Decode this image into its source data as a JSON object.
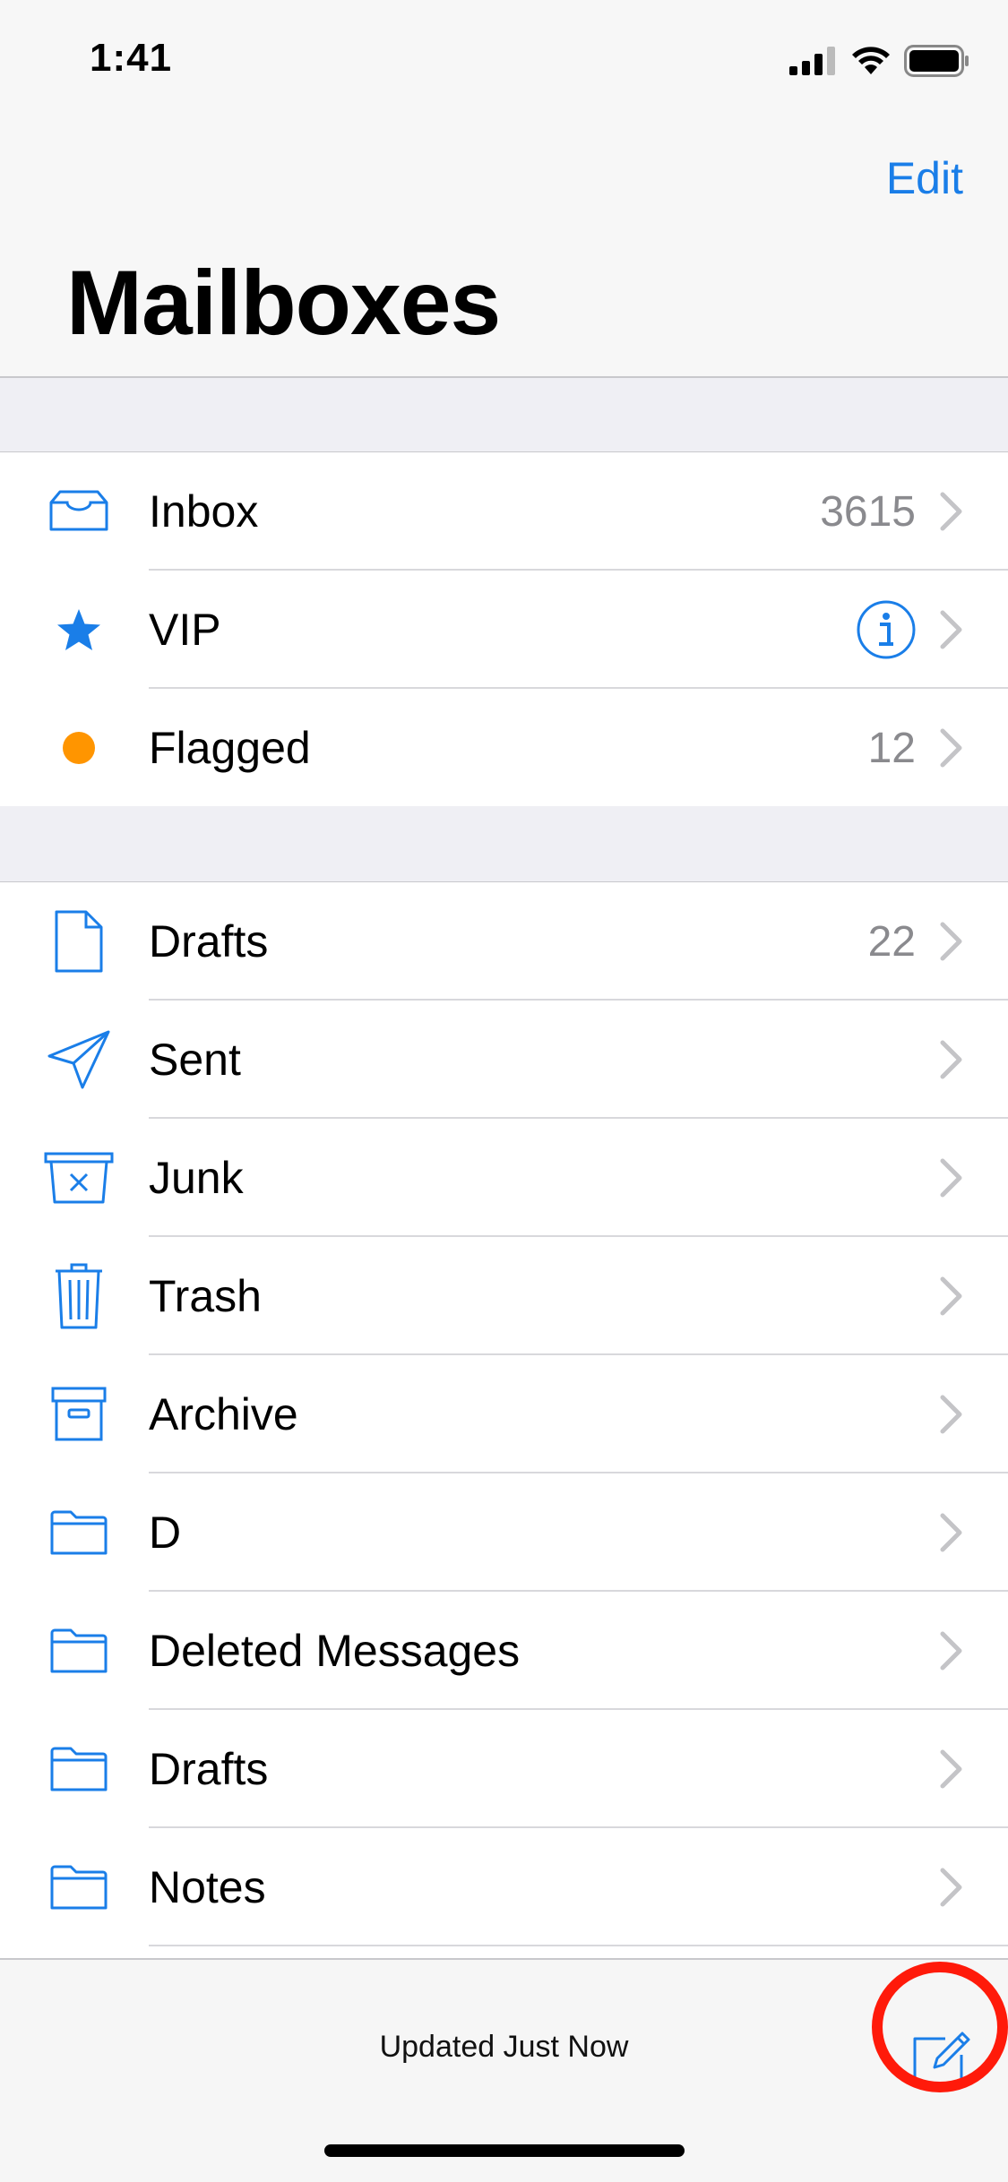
{
  "status_bar": {
    "time": "1:41",
    "icons": [
      "signal-icon",
      "wifi-icon",
      "battery-icon"
    ]
  },
  "header": {
    "edit_label": "Edit",
    "title": "Mailboxes"
  },
  "colors": {
    "accent": "#1a7ee8",
    "flag": "#ff9500",
    "highlight": "#ff1a0a"
  },
  "mailboxes": [
    {
      "label": "Inbox",
      "count": "3615",
      "icon": "inbox-tray-icon"
    },
    {
      "label": "VIP",
      "count": "",
      "icon": "star-icon"
    },
    {
      "label": "Flagged",
      "count": "12",
      "icon": "flag-dot-icon"
    }
  ],
  "folders": [
    {
      "label": "Drafts",
      "count": "22",
      "icon": "document-icon"
    },
    {
      "label": "Sent",
      "count": "",
      "icon": "paper-plane-icon"
    },
    {
      "label": "Junk",
      "count": "",
      "icon": "junk-bin-icon"
    },
    {
      "label": "Trash",
      "count": "",
      "icon": "trash-icon"
    },
    {
      "label": "Archive",
      "count": "",
      "icon": "archive-box-icon"
    },
    {
      "label": "D",
      "count": "",
      "icon": "folder-icon"
    },
    {
      "label": "Deleted Messages",
      "count": "",
      "icon": "folder-icon"
    },
    {
      "label": "Drafts",
      "count": "",
      "icon": "folder-icon"
    },
    {
      "label": "Notes",
      "count": "",
      "icon": "folder-icon"
    }
  ],
  "toolbar": {
    "status_text": "Updated Just Now"
  }
}
